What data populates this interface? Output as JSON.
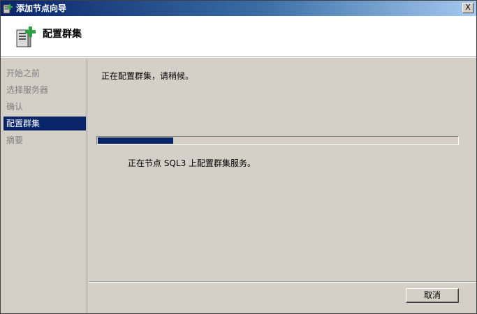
{
  "window": {
    "title": "添加节点向导",
    "close_label": "X"
  },
  "header": {
    "title": "配置群集",
    "icon": "server-add-icon"
  },
  "steps": [
    {
      "label": "开始之前",
      "active": false
    },
    {
      "label": "选择服务器",
      "active": false
    },
    {
      "label": "确认",
      "active": false
    },
    {
      "label": "配置群集",
      "active": true
    },
    {
      "label": "摘要",
      "active": false
    }
  ],
  "content": {
    "status_text": "正在配置群集，请稍候。",
    "progress": 0.21,
    "detail_text": "正在节点 SQL3 上配置群集服务。"
  },
  "footer": {
    "cancel_label": "取消"
  },
  "colors": {
    "selection": "#0a246a",
    "progress": "#0a246a",
    "face": "#d4d0c8",
    "disabled_text": "#808080"
  }
}
